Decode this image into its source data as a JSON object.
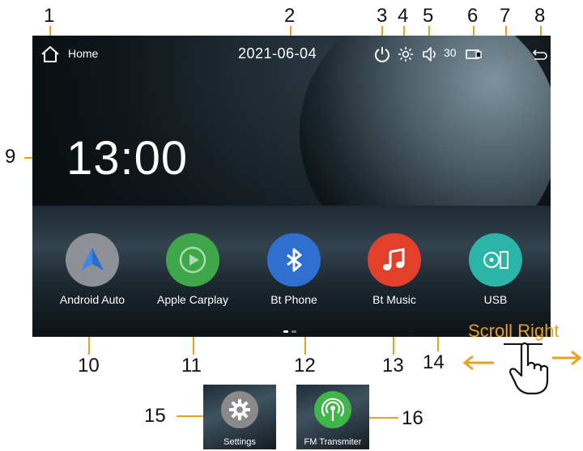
{
  "callouts": {
    "c1": "1",
    "c2": "2",
    "c3": "3",
    "c4": "4",
    "c5": "5",
    "c6": "6",
    "c7": "7",
    "c8": "8",
    "c9": "9",
    "c10": "10",
    "c11": "11",
    "c12": "12",
    "c13": "13",
    "c14": "14",
    "c15": "15",
    "c16": "16"
  },
  "status_bar": {
    "home_label": "Home",
    "date": "2021-06-04",
    "volume_value": "30",
    "icons": [
      "home-icon",
      "power-icon",
      "brightness-icon",
      "volume-icon",
      "screen-mirror-icon",
      "bluetooth-icon",
      "back-icon"
    ]
  },
  "clock": {
    "time": "13:00"
  },
  "apps": [
    {
      "label": "Android Auto",
      "color": "#8d9196"
    },
    {
      "label": "Apple Carplay",
      "color": "#3fa64a"
    },
    {
      "label": "Bt Phone",
      "color": "#2f6fd0"
    },
    {
      "label": "Bt Music",
      "color": "#e2402a"
    },
    {
      "label": "USB",
      "color": "#2bb5a8"
    }
  ],
  "secondary_apps": [
    {
      "label": "Settings",
      "color": "#8a8a8a"
    },
    {
      "label": "FM Transmiter",
      "color": "#3fb54a"
    }
  ],
  "gesture_hint": {
    "text": "Scroll Right",
    "accent": "#e8a020"
  }
}
